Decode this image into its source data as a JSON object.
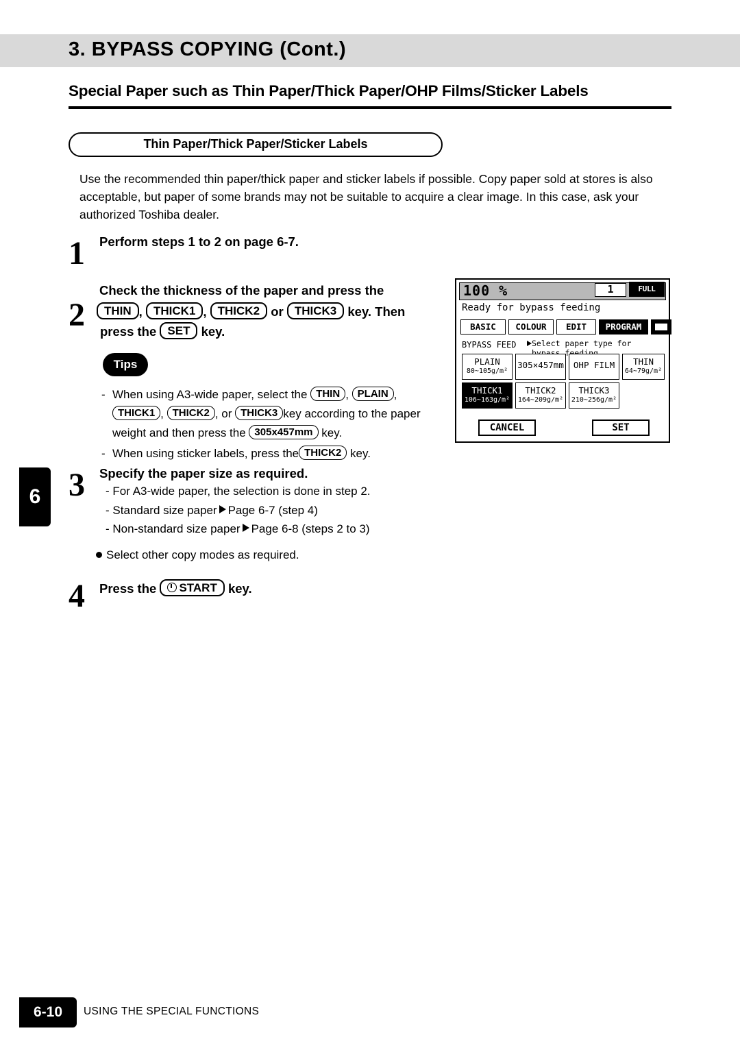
{
  "header": {
    "title": "3. BYPASS COPYING (Cont.)"
  },
  "section": {
    "heading": "Special Paper such as Thin Paper/Thick Paper/OHP Films/Sticker Labels",
    "oval_label": "Thin Paper/Thick Paper/Sticker Labels",
    "intro": "Use the recommended thin paper/thick paper and sticker labels if possible.  Copy paper sold at stores is also acceptable, but paper of some brands may not be suitable to acquire a clear image.  In this case, ask your authorized Toshiba dealer."
  },
  "steps": {
    "step1": {
      "num": "1",
      "text": "Perform steps 1 to 2 on page 6-7."
    },
    "step2": {
      "num": "2",
      "line1_pre": "Check the thickness of the paper and press the",
      "key_thin": "THIN",
      "sep1": ",",
      "key_thick1": "THICK1",
      "sep2": ",",
      "key_thick2": "THICK2",
      "or": "or",
      "key_thick3": "THICK3",
      "line2_post": "key.  Then",
      "line3_pre": "press the",
      "key_set": "SET",
      "line3_post": "key."
    },
    "step3": {
      "num": "3",
      "text": "Specify the paper size as required.",
      "items": [
        "For A3-wide paper, the selection is done in step 2.",
        "Standard size paper",
        "Non-standard size paper"
      ],
      "ref1": "Page 6-7 (step 4)",
      "ref2": "Page 6-8 (steps 2 to 3)",
      "bullet": "Select other copy modes as required."
    },
    "step4": {
      "num": "4",
      "pre": "Press the",
      "key_start": "START",
      "post": "key."
    }
  },
  "tips": {
    "label": "Tips",
    "item1_a": "When using A3-wide paper, select the",
    "item1_key1": "THIN",
    "item1_comma1": ",",
    "item1_key2": "PLAIN",
    "item1_comma2": ",",
    "item1_key3": "THICK1",
    "item1_comma3": ",",
    "item1_key4": "THICK2",
    "item1_or": ", or",
    "item1_key5": "THICK3",
    "item1_b": "key according to the paper",
    "item1_c": "weight and then press the",
    "item1_key6": "305x457mm",
    "item1_d": "key.",
    "item2_a": "When using sticker labels, press the",
    "item2_key": "THICK2",
    "item2_b": "key."
  },
  "lcd": {
    "ratio": "100 %",
    "copies": "1",
    "colour_mode": "FULL COLOUR",
    "ready": "Ready for bypass feeding",
    "tabs": [
      {
        "label": "BASIC",
        "selected": false
      },
      {
        "label": "COLOUR",
        "selected": false
      },
      {
        "label": "EDIT",
        "selected": false
      },
      {
        "label": "PROGRAM",
        "selected": true
      }
    ],
    "tab_icon": "keyboard-icon",
    "feed_label": "BYPASS FEED",
    "select_msg_line1": "Select paper type for",
    "select_msg_line2": "bypass feeding",
    "paper_buttons": [
      {
        "name": "PLAIN",
        "sub": "80~105g/m²",
        "selected": false
      },
      {
        "name": "305×457mm",
        "sub": "",
        "selected": false
      },
      {
        "name": "OHP FILM",
        "sub": "",
        "selected": false
      },
      {
        "name": "THIN",
        "sub": "64~79g/m²",
        "selected": false
      },
      {
        "name": "THICK1",
        "sub": "106~163g/m²",
        "selected": true
      },
      {
        "name": "THICK2",
        "sub": "164~209g/m²",
        "selected": false
      },
      {
        "name": "THICK3",
        "sub": "210~256g/m²",
        "selected": false
      }
    ],
    "cancel": "CANCEL",
    "set": "SET"
  },
  "chapter_tab": "6",
  "footer": {
    "page": "6-10",
    "text": "USING THE SPECIAL FUNCTIONS"
  }
}
